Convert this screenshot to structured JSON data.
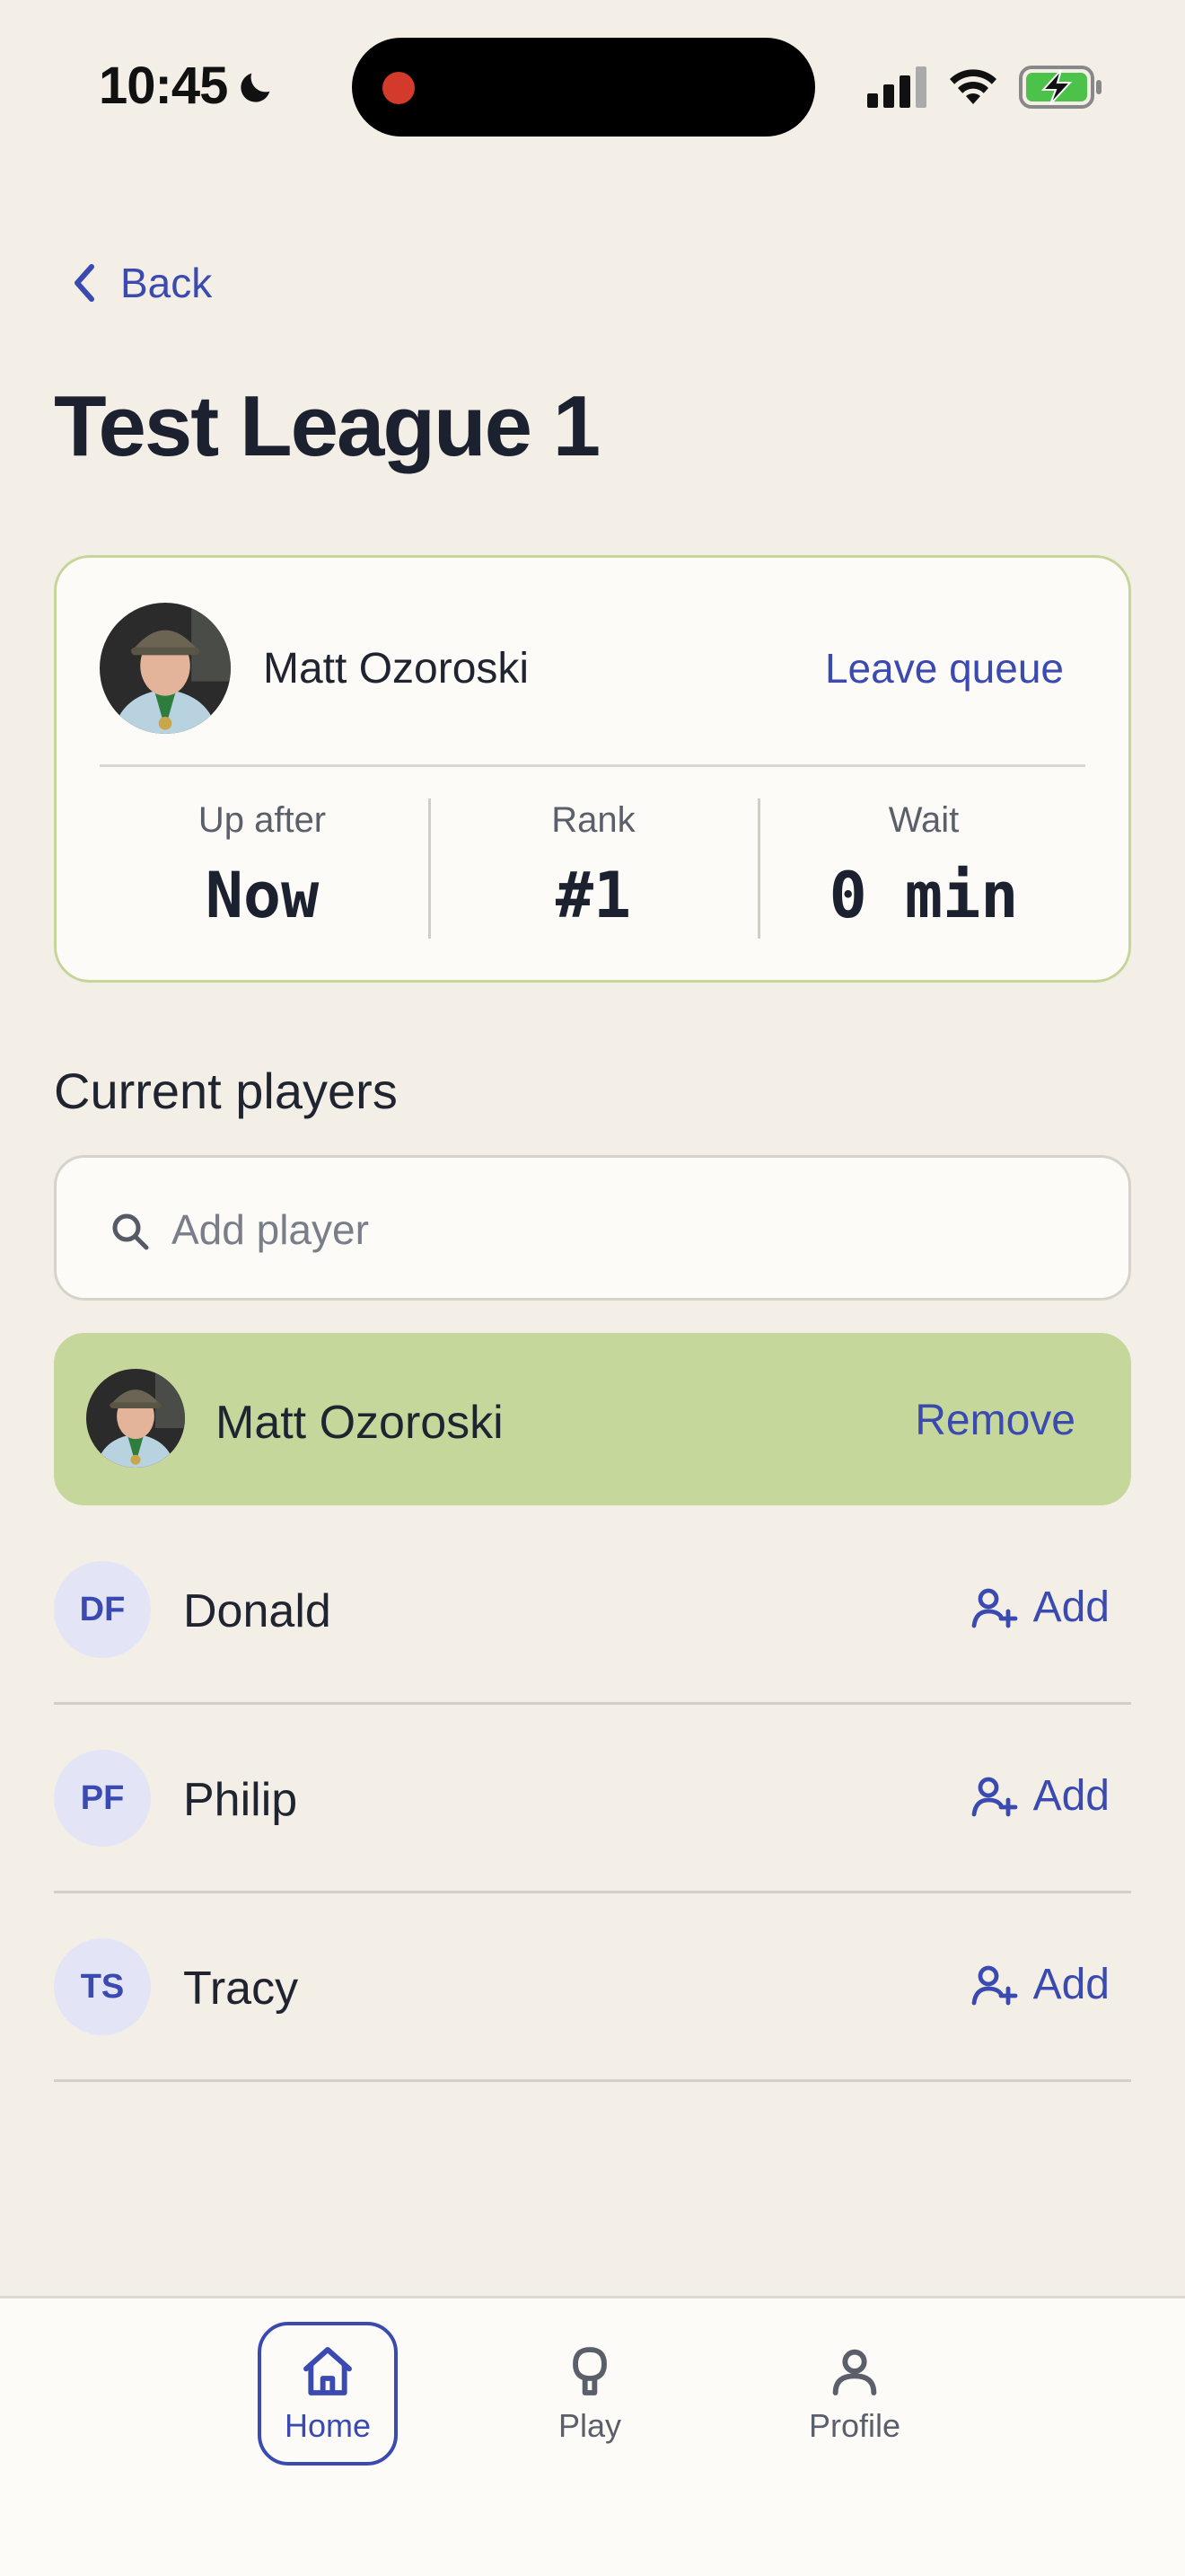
{
  "status_bar": {
    "time": "10:45"
  },
  "nav": {
    "back_label": "Back"
  },
  "page": {
    "title": "Test League 1"
  },
  "queue_card": {
    "player_name": "Matt Ozoroski",
    "leave_label": "Leave queue",
    "stats": [
      {
        "label": "Up after",
        "value": "Now"
      },
      {
        "label": "Rank",
        "value": "#1"
      },
      {
        "label": "Wait",
        "value": "0 min"
      }
    ]
  },
  "current_players": {
    "title": "Current players",
    "search_placeholder": "Add player",
    "current": {
      "name": "Matt Ozoroski",
      "remove_label": "Remove"
    },
    "players": [
      {
        "initials": "DF",
        "name": "Donald",
        "add_label": "Add"
      },
      {
        "initials": "PF",
        "name": "Philip",
        "add_label": "Add"
      },
      {
        "initials": "TS",
        "name": "Tracy",
        "add_label": "Add"
      }
    ]
  },
  "tab_bar": {
    "tabs": [
      {
        "label": "Home",
        "icon": "home-icon",
        "active": true
      },
      {
        "label": "Play",
        "icon": "paddle-icon",
        "active": false
      },
      {
        "label": "Profile",
        "icon": "person-icon",
        "active": false
      }
    ]
  },
  "colors": {
    "accent": "#3a4ab0",
    "highlight": "#c5d79b",
    "background": "#f3efe7",
    "card_border": "#c6d69a"
  }
}
